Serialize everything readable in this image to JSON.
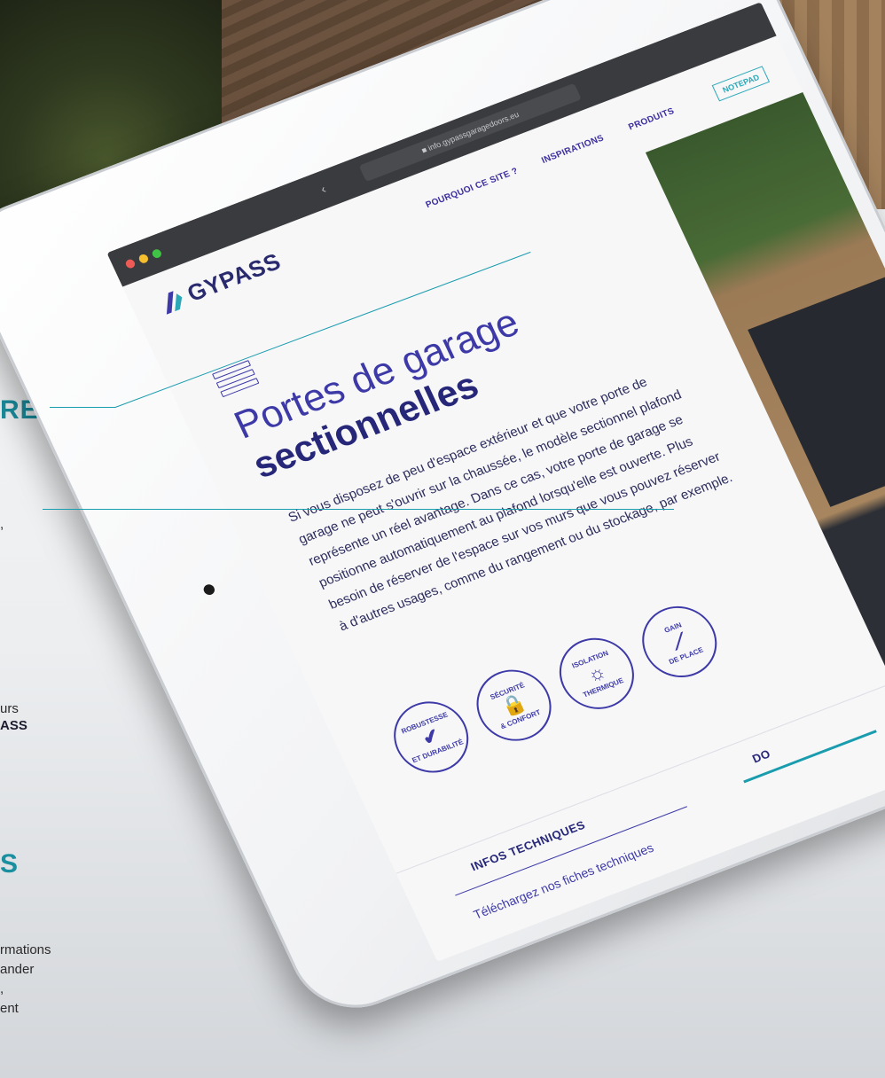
{
  "side": {
    "heading1": "RE",
    "heading2": "S",
    "text_a": ",",
    "text_b": "urs",
    "brand_fragment": "ASS",
    "info_lines": [
      "rmations",
      "ander",
      ",",
      "ent"
    ]
  },
  "browser": {
    "url": "■ info.gypassgaragedoors.eu"
  },
  "site": {
    "logo": "GYPASS",
    "nav": [
      "POURQUOI CE SITE ?",
      "INSPIRATIONS",
      "PRODUITS"
    ],
    "notepad": "NOTEPAD"
  },
  "page": {
    "title_line1": "Portes de garage",
    "title_line2": "sectionnelles",
    "description": "Si vous disposez de peu d'espace extérieur et que votre porte de garage ne peut s'ouvrir sur la chaussée, le modèle sectionnel plafond représente un réel avantage. Dans ce cas, votre porte de garage se positionne automatiquement au plafond lorsqu'elle est ouverte. Plus besoin de réserver de l'espace sur vos murs que vous pouvez réserver à d'autres usages, comme du rangement ou du stockage, par exemple."
  },
  "badges": [
    {
      "label_top": "ROBUSTESSE",
      "label_bottom": "ET DURABILITÉ",
      "icon": "shield-check-icon"
    },
    {
      "label_top": "SÉCURITÉ",
      "label_bottom": "& CONFORT",
      "icon": "lock-icon"
    },
    {
      "label_top": "ISOLATION",
      "label_bottom": "THERMIQUE",
      "icon": "sun-icon"
    },
    {
      "label_top": "GAIN",
      "label_bottom": "DE PLACE",
      "icon": "ruler-icon"
    }
  ],
  "tabs": {
    "infos": "INFOS TECHNIQUES",
    "docs": "DO"
  },
  "download": "Téléchargez nos fiches techniques",
  "colors": {
    "accent": "#1a9caf",
    "brand": "#3d3aa8",
    "brand_dark": "#27277a"
  }
}
